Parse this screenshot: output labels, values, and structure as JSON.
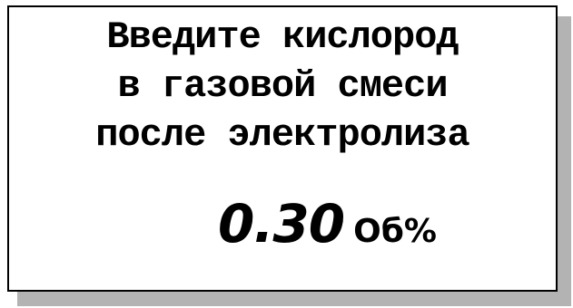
{
  "screen": {
    "prompt_lines": [
      "Введите кислород",
      "в газовой смеси",
      "после электролиза"
    ],
    "value": "0.30",
    "unit": "Об%"
  }
}
